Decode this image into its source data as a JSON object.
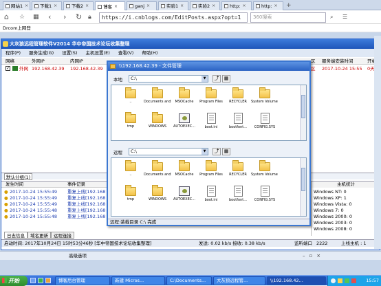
{
  "browser": {
    "tabs": [
      {
        "label": "网站1"
      },
      {
        "label": "下载1"
      },
      {
        "label": "下载2"
      },
      {
        "label": "博客"
      },
      {
        "label": "ganj"
      },
      {
        "label": "实验1"
      },
      {
        "label": "实验2"
      },
      {
        "label": "http:"
      },
      {
        "label": "http:"
      }
    ],
    "url": "https://i.cnblogs.com/EditPosts.aspx?opt=1",
    "search_placeholder": "360搜索",
    "bookmark": "Drcom上网登"
  },
  "app": {
    "title": "大灰狼远程管理软件V2014   华中帝国技术论坛收集整理",
    "menu": [
      "程序(P)",
      "服务生成(G)",
      "设置(S)",
      "主机设置(E)",
      "查看(V)",
      "帮助(H)"
    ],
    "grid_headers": [
      "网络",
      "外网IP",
      "内网IP",
      "区",
      "服务端安装时间",
      "开机运行"
    ],
    "grid_row": {
      "net": "外网",
      "wan_ip": "192.168.42.39",
      "lan_ip": "192.168.42.39",
      "region": "区",
      "install_time": "2017-10-24 15:55",
      "uptime": "0天0时"
    },
    "group_tab": "默认分组(1)",
    "log_headers": {
      "time": "发生时间",
      "event": "事件记录"
    },
    "log_rows": [
      {
        "time": "2017-10-24 15:55:49",
        "event": "重复上线[192.168"
      },
      {
        "time": "2017-10-24 15:55:49",
        "event": "重复上线[192.168"
      },
      {
        "time": "2017-10-24 15:55:49",
        "event": "重复上线[192.168"
      },
      {
        "time": "2017-10-24 15:55:48",
        "event": "重复上线[192.168"
      },
      {
        "time": "2017-10-24 15:55:48",
        "event": "重复上线[192.168"
      }
    ],
    "stats_title": "主机统计",
    "stats": [
      {
        "os": "Windows NT:",
        "count": "0"
      },
      {
        "os": "Windows XP:",
        "count": "1"
      },
      {
        "os": "Windows Vista:",
        "count": "0"
      },
      {
        "os": "Windows 7:",
        "count": "0"
      },
      {
        "os": "Windows 2000:",
        "count": "0"
      },
      {
        "os": "Windows 2003:",
        "count": "0"
      },
      {
        "os": "Windows 2008:",
        "count": "0"
      }
    ],
    "log_tabs": [
      "日志信息",
      "域名更新",
      "远程连接"
    ],
    "status": {
      "start": "启动时间: 2017年10月24日 15时53分46秒 [华中帝国技术论坛收集整理]",
      "speed": "发送: 0.02 kb/s 接收: 0.38 kb/s",
      "port_label": "监听端口",
      "port": "2222",
      "online": "上线主机 : 1"
    },
    "advanced": "高级选项"
  },
  "dialog": {
    "title": "\\\\192.168.42.39 - 文件管理",
    "local_label": "本地",
    "local_path": "C:\\",
    "remote_label": "远程",
    "remote_path": "C:\\",
    "local_items": [
      {
        "name": "..",
        "icon": "folder-icon"
      },
      {
        "name": "Documents and Se...",
        "icon": "folder-icon"
      },
      {
        "name": "MSOCache",
        "icon": "folder-icon"
      },
      {
        "name": "Program Files",
        "icon": "folder-icon"
      },
      {
        "name": "RECYCLER",
        "icon": "folder-icon"
      },
      {
        "name": "System Volume I...",
        "icon": "folder-icon"
      },
      {
        "name": "tmp",
        "icon": "folder-icon"
      },
      {
        "name": "WINDOWS",
        "icon": "folder-icon"
      },
      {
        "name": "AUTOEXEC...",
        "icon": "exe-icon"
      },
      {
        "name": "boot.ini",
        "icon": "file-icon"
      },
      {
        "name": "bootfont...",
        "icon": "file-icon"
      },
      {
        "name": "CONFIG.SYS",
        "icon": "file-icon"
      }
    ],
    "remote_items": [
      {
        "name": "..",
        "icon": "folder-icon"
      },
      {
        "name": "Documents and Se...",
        "icon": "folder-icon"
      },
      {
        "name": "MSOCache",
        "icon": "folder-icon"
      },
      {
        "name": "Program Files",
        "icon": "folder-icon"
      },
      {
        "name": "RECYCLER",
        "icon": "folder-icon"
      },
      {
        "name": "System Volume I...",
        "icon": "folder-icon"
      },
      {
        "name": "tmp",
        "icon": "folder-icon"
      },
      {
        "name": "WINDOWS",
        "icon": "folder-icon"
      },
      {
        "name": "AUTOEXEC...",
        "icon": "exe-icon"
      },
      {
        "name": "boot.ini",
        "icon": "file-icon"
      },
      {
        "name": "bootfont...",
        "icon": "file-icon"
      },
      {
        "name": "CONFIG.SYS",
        "icon": "file-icon"
      }
    ],
    "status": "远程:装载目录 C:\\ 完成"
  },
  "taskbar": {
    "start": "开始",
    "buttons": [
      {
        "label": "博客后台管理"
      },
      {
        "label": "新建 Micros..."
      },
      {
        "label": "C:\\Documents..."
      },
      {
        "label": "大灰狼远程管..."
      },
      {
        "label": "\\\\192.168.42..."
      }
    ],
    "clock": "15:57"
  },
  "colors": {
    "title_blue": "#1e55b9",
    "taskbar_blue": "#245bc8",
    "start_green": "#2f8c2f",
    "log_blue": "#1f3fb0",
    "online_red": "#cc0000"
  }
}
